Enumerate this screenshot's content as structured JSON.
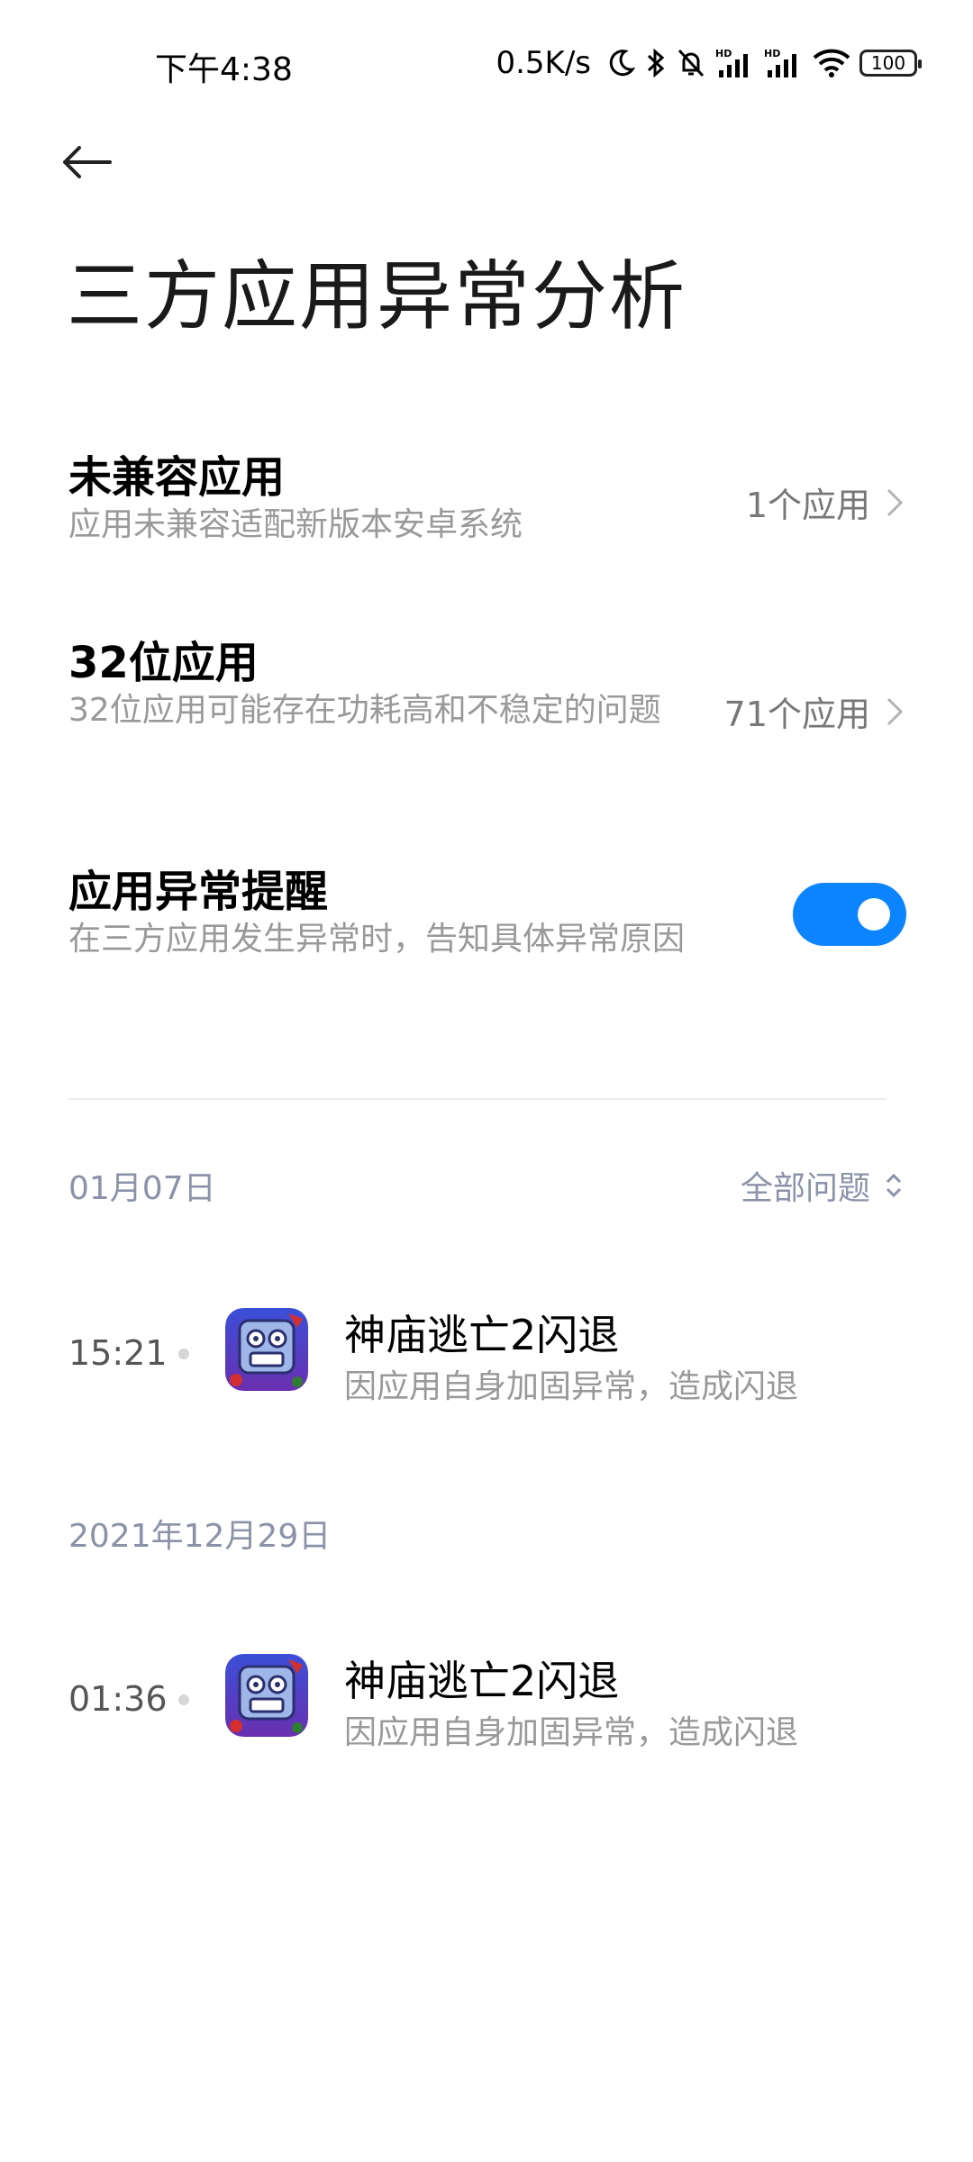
{
  "status_bar": {
    "time": "下午4:38",
    "net_speed": "0.5K/s",
    "battery": "100",
    "icons": [
      "moon-icon",
      "bluetooth-icon",
      "mute-bell-icon",
      "hd-signal-icon",
      "hd-signal-icon",
      "wifi-icon",
      "battery-icon"
    ]
  },
  "page": {
    "title": "三方应用异常分析"
  },
  "settings": {
    "incompatible": {
      "title": "未兼容应用",
      "desc": "应用未兼容适配新版本安卓系统",
      "value": "1个应用"
    },
    "bit32": {
      "title": "32位应用",
      "desc": "32位应用可能存在功耗高和不稳定的问题",
      "value": "71个应用"
    },
    "alert": {
      "title": "应用异常提醒",
      "desc": "在三方应用发生异常时，告知具体异常原因",
      "enabled": true
    }
  },
  "filter": {
    "label": "全部问题"
  },
  "logs": [
    {
      "date": "01月07日",
      "time": "15:21",
      "title": "神庙逃亡2闪退",
      "desc": "因应用自身加固异常，造成闪退"
    },
    {
      "date": "2021年12月29日",
      "time": "01:36",
      "title": "神庙逃亡2闪退",
      "desc": "因应用自身加固异常，造成闪退"
    }
  ],
  "colors": {
    "accent": "#0d84ff",
    "date_text": "#8c92a8"
  }
}
